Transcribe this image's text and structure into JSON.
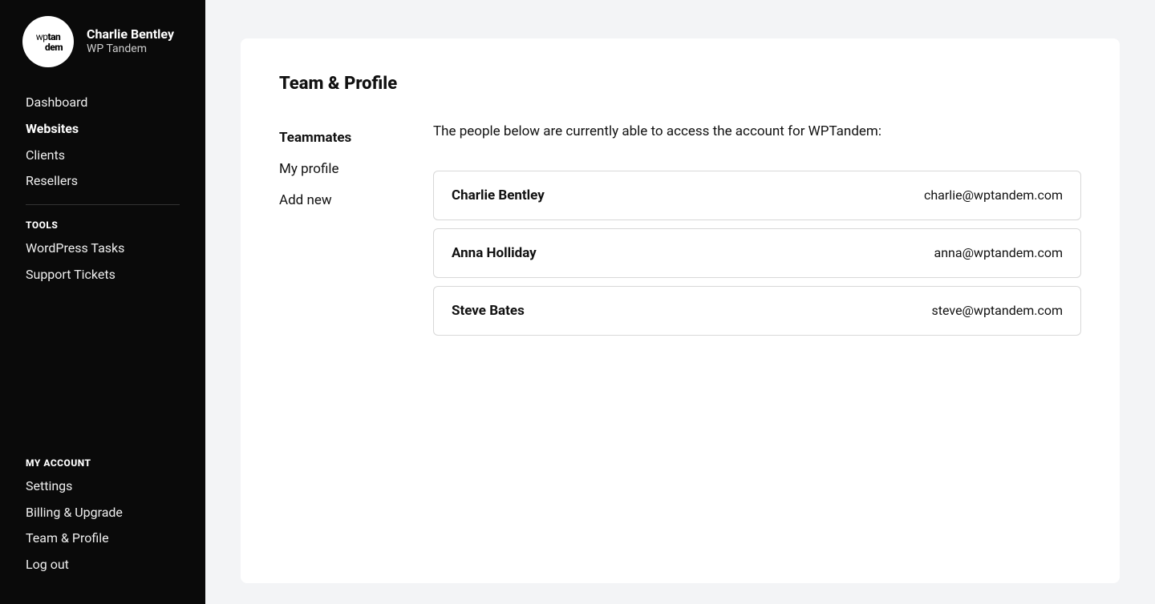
{
  "sidebar": {
    "logo_line1_prefix": "wp",
    "logo_line1_bold": "tan",
    "logo_line2": "dem",
    "user_name": "Charlie Bentley",
    "user_org": "WP Tandem",
    "nav_main": [
      {
        "label": "Dashboard",
        "active": false
      },
      {
        "label": "Websites",
        "active": true
      },
      {
        "label": "Clients",
        "active": false
      },
      {
        "label": "Resellers",
        "active": false
      }
    ],
    "tools_heading": "TOOLS",
    "nav_tools": [
      {
        "label": "WordPress Tasks"
      },
      {
        "label": "Support Tickets"
      }
    ],
    "account_heading": "MY ACCOUNT",
    "nav_account": [
      {
        "label": "Settings"
      },
      {
        "label": "Billing & Upgrade"
      },
      {
        "label": "Team & Profile"
      },
      {
        "label": "Log out"
      }
    ]
  },
  "page": {
    "title": "Team & Profile",
    "subnav": [
      {
        "label": "Teammates",
        "active": true
      },
      {
        "label": "My profile",
        "active": false
      },
      {
        "label": "Add new",
        "active": false
      }
    ],
    "intro": "The people below are currently able to access the account for WPTandem:",
    "teammates": [
      {
        "name": "Charlie Bentley",
        "email": "charlie@wptandem.com"
      },
      {
        "name": "Anna Holliday",
        "email": "anna@wptandem.com"
      },
      {
        "name": "Steve Bates",
        "email": "steve@wptandem.com"
      }
    ]
  }
}
